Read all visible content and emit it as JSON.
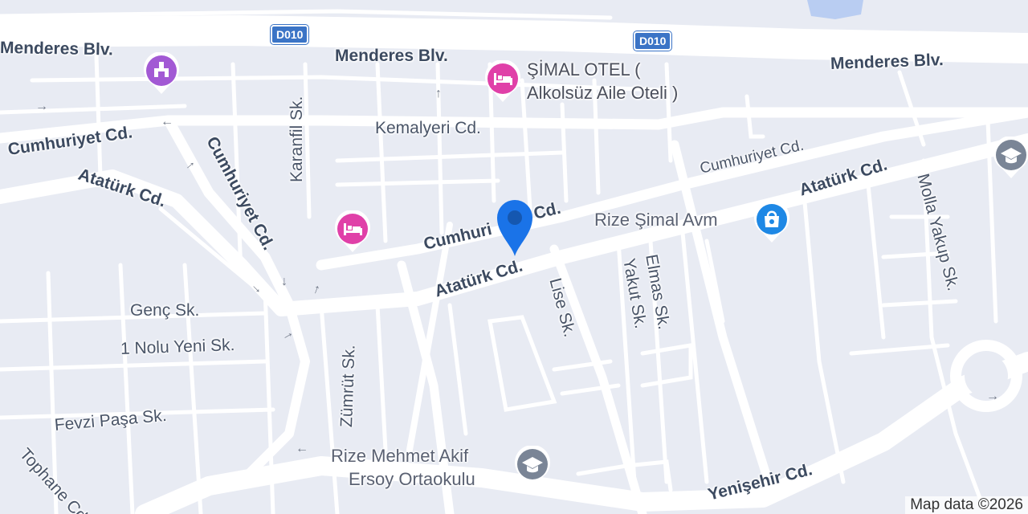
{
  "map": {
    "roads": {
      "d010_label": "D010",
      "menderes_blv": "Menderes Blv.",
      "cumhuriyet_cd": "Cumhuriyet Cd.",
      "cumhuriyet_cd_partial": "Cumhuri",
      "cumhuriyet_cd_suffix": "Cd.",
      "ataturk_cd": "Atatürk Cd.",
      "karanfil_sk": "Karanfil Sk.",
      "kemalyeri_cd": "Kemalyeri Cd.",
      "molla_yakup_sk": "Molla Yakup Sk.",
      "lise_sk": "Lise Sk.",
      "yakut_sk": "Yakut Sk.",
      "elmas_sk": "Elmas Sk.",
      "genc_sk": "Genç Sk.",
      "nolu_yeni_sk": "1 Nolu Yeni Sk.",
      "zumrut_sk": "Zümrüt Sk.",
      "fevzi_pasa_sk": "Fevzi Paşa Sk.",
      "tophane_cd": "Tophane Cd.",
      "yenisehir_cd": "Yenişehir Cd."
    },
    "pois": {
      "simal_otel_line1": "ŞİMAL OTEL (",
      "simal_otel_line2": "Alkolsüz Aile Oteli )",
      "rize_simal_avm": "Rize Şimal Avm",
      "ortaokulu_line1": "Rize Mehmet Akif",
      "ortaokulu_line2": "Ersoy Ortaokulu"
    },
    "attribution": "Map data ©2026",
    "colors": {
      "background": "#e8ebf3",
      "road": "#ffffff",
      "hotel_pin": "#e040a8",
      "shopping_pin": "#1e88e5",
      "school_pin": "#7a8596",
      "location_pin": "#1a73e8",
      "shield": "#3b74c6"
    },
    "icons": [
      "hotel-icon",
      "shopping-bag-icon",
      "school-icon",
      "landmark-icon",
      "location-pin-icon"
    ]
  }
}
